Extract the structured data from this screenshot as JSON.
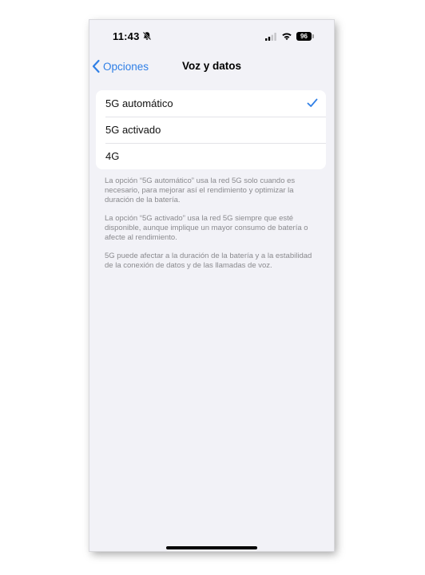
{
  "status_bar": {
    "time": "11:43",
    "battery_level": "96",
    "icons": [
      "bell-slash-icon",
      "signal-icon",
      "wifi-icon",
      "battery-icon"
    ]
  },
  "nav": {
    "back_label": "Opciones",
    "title": "Voz y datos"
  },
  "options": [
    {
      "label": "5G automático",
      "selected": true
    },
    {
      "label": "5G activado",
      "selected": false
    },
    {
      "label": "4G",
      "selected": false
    }
  ],
  "notes": [
    "La opción “5G automático” usa la red 5G solo cuando es necesario, para mejorar así el rendimiento y optimizar la duración de la batería.",
    "La opción “5G activado” usa la red 5G siempre que esté disponible, aunque implique un mayor consumo de batería o afecte al rendimiento.",
    "5G puede afectar a la duración de la batería y a la estabilidad de la conexión de datos y de las llamadas de voz."
  ],
  "colors": {
    "accent": "#2f7fe6",
    "background": "#f2f2f7",
    "secondary_text": "#8a8a8e"
  }
}
